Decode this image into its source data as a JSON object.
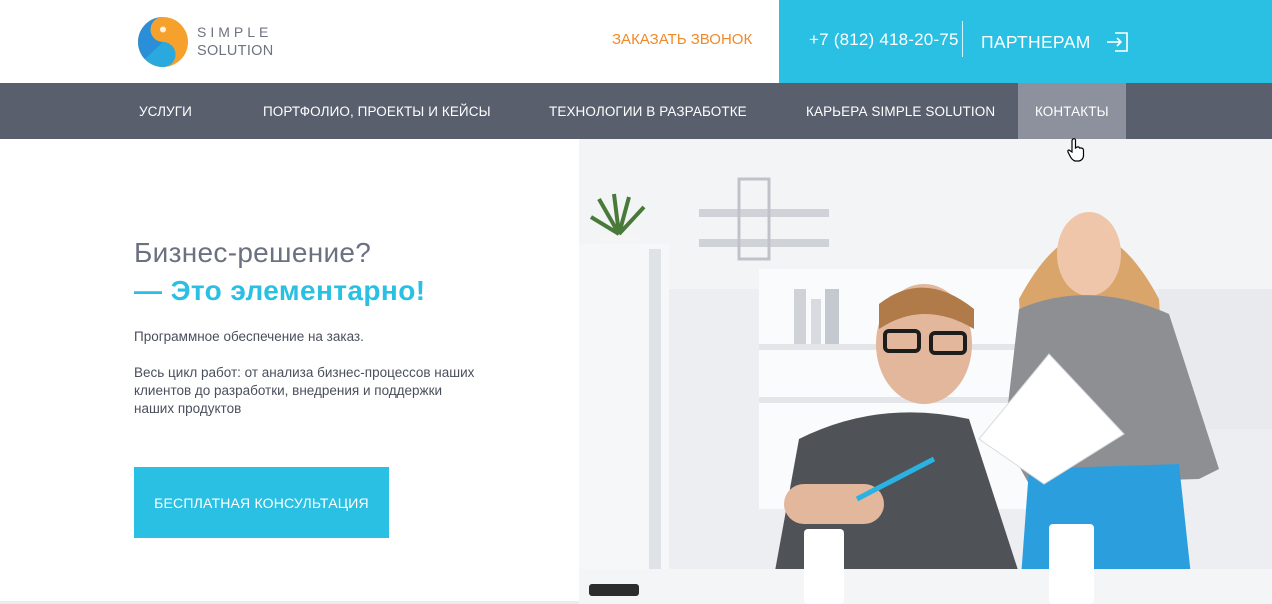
{
  "header": {
    "logo_line1": "SIMPLE",
    "logo_line2": "SOLUTION",
    "callback_label": "ЗАКАЗАТЬ ЗВОНОК",
    "phone": "+7 (812) 418-20-75",
    "partners_label": "ПАРТНЕРАМ",
    "icons": {
      "logo": "simple-solution-logo",
      "partners": "login-arrow-icon"
    },
    "colors": {
      "accent_cyan": "#29c0e4",
      "accent_orange": "#ef8a2a",
      "nav_bg": "#5a5f6e",
      "nav_active_bg": "#8c919d"
    }
  },
  "nav": {
    "items": [
      {
        "label": "УСЛУГИ"
      },
      {
        "label": "ПОРТФОЛИО, ПРОЕКТЫ И КЕЙСЫ"
      },
      {
        "label": "ТЕХНОЛОГИИ В РАЗРАБОТКЕ"
      },
      {
        "label": "КАРЬЕРА SIMPLE SOLUTION"
      },
      {
        "label": "КОНТАКТЫ",
        "active": true
      }
    ]
  },
  "hero": {
    "title_line1": "Бизнес-решение?",
    "title_line2": "— Это элементарно!",
    "subtitle": "Программное обеспечение на заказ.",
    "description": "Весь цикл работ: от анализа бизнес-процессов наших клиентов до разработки, внедрения и поддержки наших продуктов",
    "cta_label": "БЕСПЛАТНАЯ КОНСУЛЬТАЦИЯ",
    "image": "office-team-photo"
  }
}
